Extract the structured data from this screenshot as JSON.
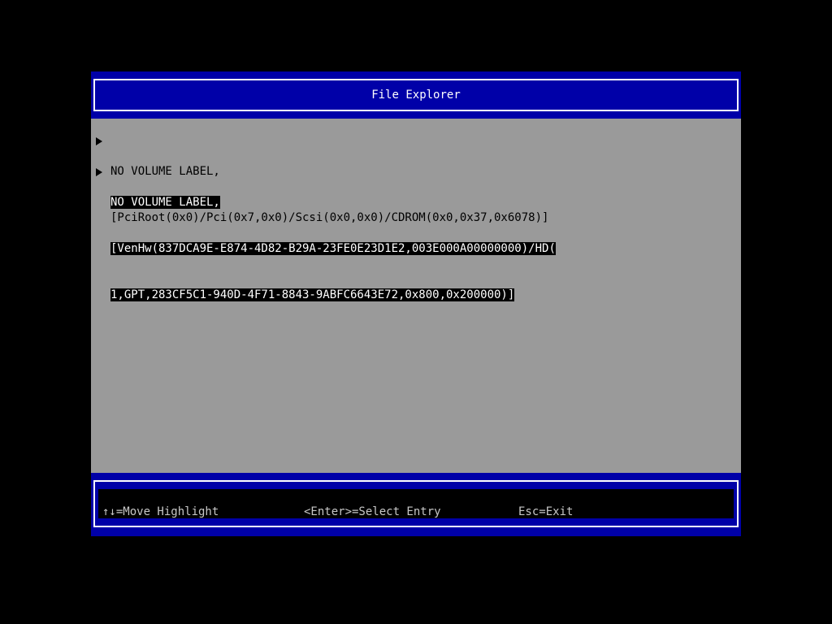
{
  "header": {
    "title": "File Explorer"
  },
  "entries": [
    {
      "lines": [
        "NO VOLUME LABEL,",
        "[PciRoot(0x0)/Pci(0x7,0x0)/Scsi(0x0,0x0)/CDROM(0x0,0x37,0x6078)]"
      ],
      "selected": false,
      "icon": "right-triangle-icon"
    },
    {
      "lines": [
        "NO VOLUME LABEL,",
        "[VenHw(837DCA9E-E874-4D82-B29A-23FE0E23D1E2,003E000A00000000)/HD(",
        "1,GPT,283CF5C1-940D-4F71-8843-9ABFC6643E72,0x800,0x200000)]"
      ],
      "selected": true,
      "icon": "right-triangle-icon"
    }
  ],
  "footer": {
    "move_hint": "↑↓=Move Highlight",
    "select_hint": "<Enter>=Select Entry",
    "exit_hint": "Esc=Exit"
  },
  "colors": {
    "header_bg": "#0000a8",
    "body_bg": "#9a9a9a",
    "highlight_bg": "#000000",
    "highlight_fg": "#ffffff"
  }
}
